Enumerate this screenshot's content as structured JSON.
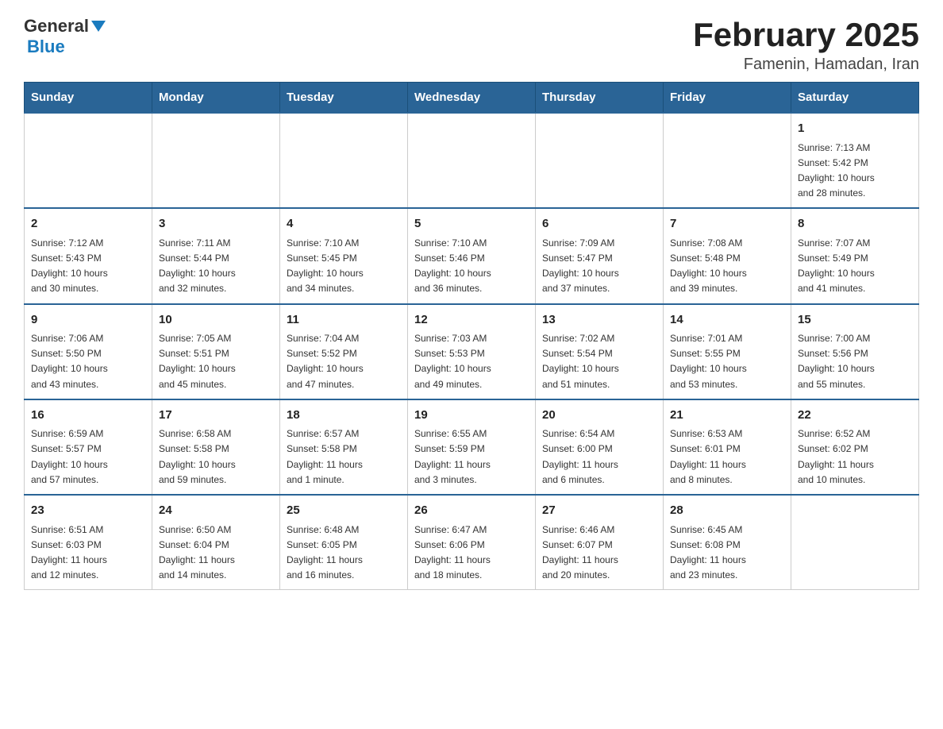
{
  "header": {
    "logo_general": "General",
    "logo_blue": "Blue",
    "title": "February 2025",
    "subtitle": "Famenin, Hamadan, Iran"
  },
  "weekdays": [
    "Sunday",
    "Monday",
    "Tuesday",
    "Wednesday",
    "Thursday",
    "Friday",
    "Saturday"
  ],
  "rows": [
    [
      {
        "day": "",
        "info": ""
      },
      {
        "day": "",
        "info": ""
      },
      {
        "day": "",
        "info": ""
      },
      {
        "day": "",
        "info": ""
      },
      {
        "day": "",
        "info": ""
      },
      {
        "day": "",
        "info": ""
      },
      {
        "day": "1",
        "info": "Sunrise: 7:13 AM\nSunset: 5:42 PM\nDaylight: 10 hours\nand 28 minutes."
      }
    ],
    [
      {
        "day": "2",
        "info": "Sunrise: 7:12 AM\nSunset: 5:43 PM\nDaylight: 10 hours\nand 30 minutes."
      },
      {
        "day": "3",
        "info": "Sunrise: 7:11 AM\nSunset: 5:44 PM\nDaylight: 10 hours\nand 32 minutes."
      },
      {
        "day": "4",
        "info": "Sunrise: 7:10 AM\nSunset: 5:45 PM\nDaylight: 10 hours\nand 34 minutes."
      },
      {
        "day": "5",
        "info": "Sunrise: 7:10 AM\nSunset: 5:46 PM\nDaylight: 10 hours\nand 36 minutes."
      },
      {
        "day": "6",
        "info": "Sunrise: 7:09 AM\nSunset: 5:47 PM\nDaylight: 10 hours\nand 37 minutes."
      },
      {
        "day": "7",
        "info": "Sunrise: 7:08 AM\nSunset: 5:48 PM\nDaylight: 10 hours\nand 39 minutes."
      },
      {
        "day": "8",
        "info": "Sunrise: 7:07 AM\nSunset: 5:49 PM\nDaylight: 10 hours\nand 41 minutes."
      }
    ],
    [
      {
        "day": "9",
        "info": "Sunrise: 7:06 AM\nSunset: 5:50 PM\nDaylight: 10 hours\nand 43 minutes."
      },
      {
        "day": "10",
        "info": "Sunrise: 7:05 AM\nSunset: 5:51 PM\nDaylight: 10 hours\nand 45 minutes."
      },
      {
        "day": "11",
        "info": "Sunrise: 7:04 AM\nSunset: 5:52 PM\nDaylight: 10 hours\nand 47 minutes."
      },
      {
        "day": "12",
        "info": "Sunrise: 7:03 AM\nSunset: 5:53 PM\nDaylight: 10 hours\nand 49 minutes."
      },
      {
        "day": "13",
        "info": "Sunrise: 7:02 AM\nSunset: 5:54 PM\nDaylight: 10 hours\nand 51 minutes."
      },
      {
        "day": "14",
        "info": "Sunrise: 7:01 AM\nSunset: 5:55 PM\nDaylight: 10 hours\nand 53 minutes."
      },
      {
        "day": "15",
        "info": "Sunrise: 7:00 AM\nSunset: 5:56 PM\nDaylight: 10 hours\nand 55 minutes."
      }
    ],
    [
      {
        "day": "16",
        "info": "Sunrise: 6:59 AM\nSunset: 5:57 PM\nDaylight: 10 hours\nand 57 minutes."
      },
      {
        "day": "17",
        "info": "Sunrise: 6:58 AM\nSunset: 5:58 PM\nDaylight: 10 hours\nand 59 minutes."
      },
      {
        "day": "18",
        "info": "Sunrise: 6:57 AM\nSunset: 5:58 PM\nDaylight: 11 hours\nand 1 minute."
      },
      {
        "day": "19",
        "info": "Sunrise: 6:55 AM\nSunset: 5:59 PM\nDaylight: 11 hours\nand 3 minutes."
      },
      {
        "day": "20",
        "info": "Sunrise: 6:54 AM\nSunset: 6:00 PM\nDaylight: 11 hours\nand 6 minutes."
      },
      {
        "day": "21",
        "info": "Sunrise: 6:53 AM\nSunset: 6:01 PM\nDaylight: 11 hours\nand 8 minutes."
      },
      {
        "day": "22",
        "info": "Sunrise: 6:52 AM\nSunset: 6:02 PM\nDaylight: 11 hours\nand 10 minutes."
      }
    ],
    [
      {
        "day": "23",
        "info": "Sunrise: 6:51 AM\nSunset: 6:03 PM\nDaylight: 11 hours\nand 12 minutes."
      },
      {
        "day": "24",
        "info": "Sunrise: 6:50 AM\nSunset: 6:04 PM\nDaylight: 11 hours\nand 14 minutes."
      },
      {
        "day": "25",
        "info": "Sunrise: 6:48 AM\nSunset: 6:05 PM\nDaylight: 11 hours\nand 16 minutes."
      },
      {
        "day": "26",
        "info": "Sunrise: 6:47 AM\nSunset: 6:06 PM\nDaylight: 11 hours\nand 18 minutes."
      },
      {
        "day": "27",
        "info": "Sunrise: 6:46 AM\nSunset: 6:07 PM\nDaylight: 11 hours\nand 20 minutes."
      },
      {
        "day": "28",
        "info": "Sunrise: 6:45 AM\nSunset: 6:08 PM\nDaylight: 11 hours\nand 23 minutes."
      },
      {
        "day": "",
        "info": ""
      }
    ]
  ]
}
